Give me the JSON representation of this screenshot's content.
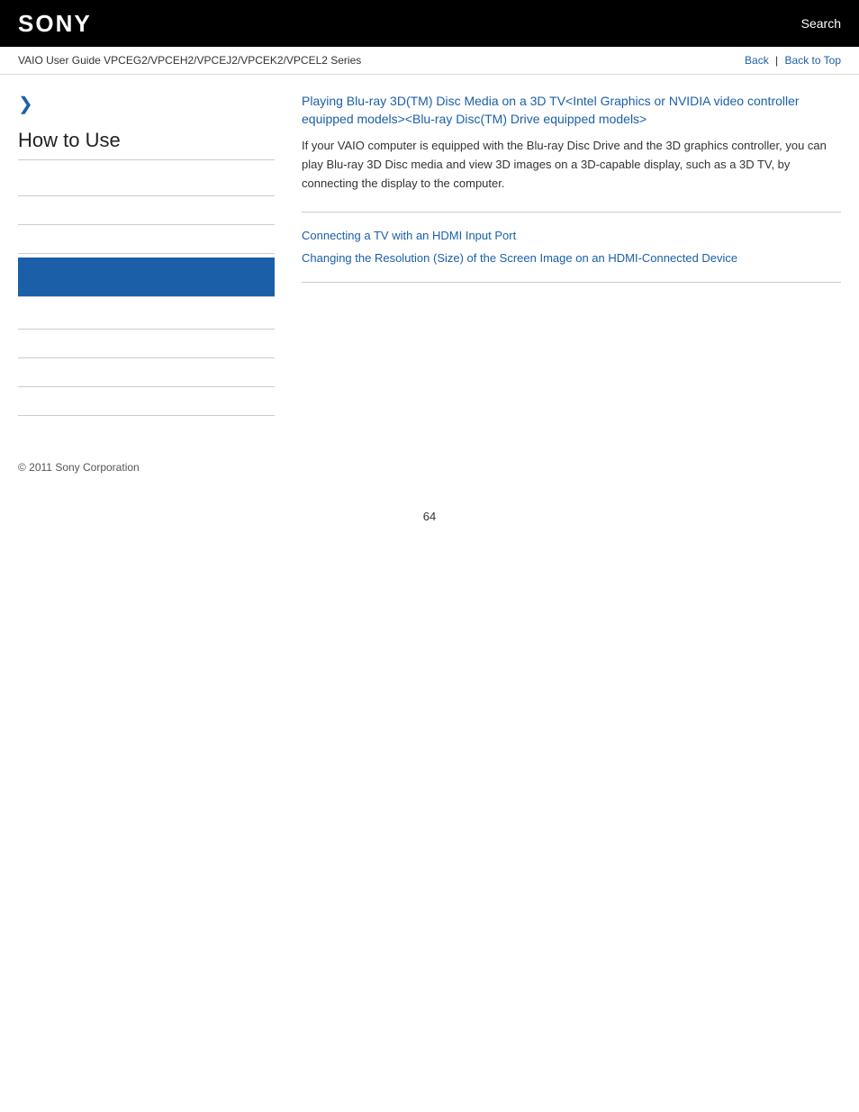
{
  "header": {
    "logo": "SONY",
    "search_label": "Search"
  },
  "breadcrumb": {
    "text": "VAIO User Guide VPCEG2/VPCEH2/VPCEJ2/VPCEK2/VPCEL2 Series",
    "back_label": "Back",
    "back_to_top_label": "Back to Top"
  },
  "sidebar": {
    "arrow": "❯",
    "title": "How to Use",
    "items": [
      {
        "label": ""
      },
      {
        "label": ""
      },
      {
        "label": ""
      },
      {
        "label": ""
      },
      {
        "label": ""
      },
      {
        "label": ""
      },
      {
        "label": ""
      },
      {
        "label": ""
      }
    ]
  },
  "content": {
    "main_link_title": "Playing Blu-ray 3D(TM) Disc Media on a 3D TV<Intel Graphics or NVIDIA video controller equipped models><Blu-ray Disc(TM) Drive equipped models>",
    "main_description": "If your VAIO computer is equipped with the Blu-ray Disc Drive and the 3D graphics controller, you can play Blu-ray 3D Disc media and view 3D images on a 3D-capable display, such as a 3D TV, by connecting the display to the computer.",
    "link1": "Connecting a TV with an HDMI Input Port",
    "link2": "Changing the Resolution (Size) of the Screen Image on an HDMI-Connected Device"
  },
  "footer": {
    "copyright": "© 2011 Sony Corporation"
  },
  "page_number": "64"
}
